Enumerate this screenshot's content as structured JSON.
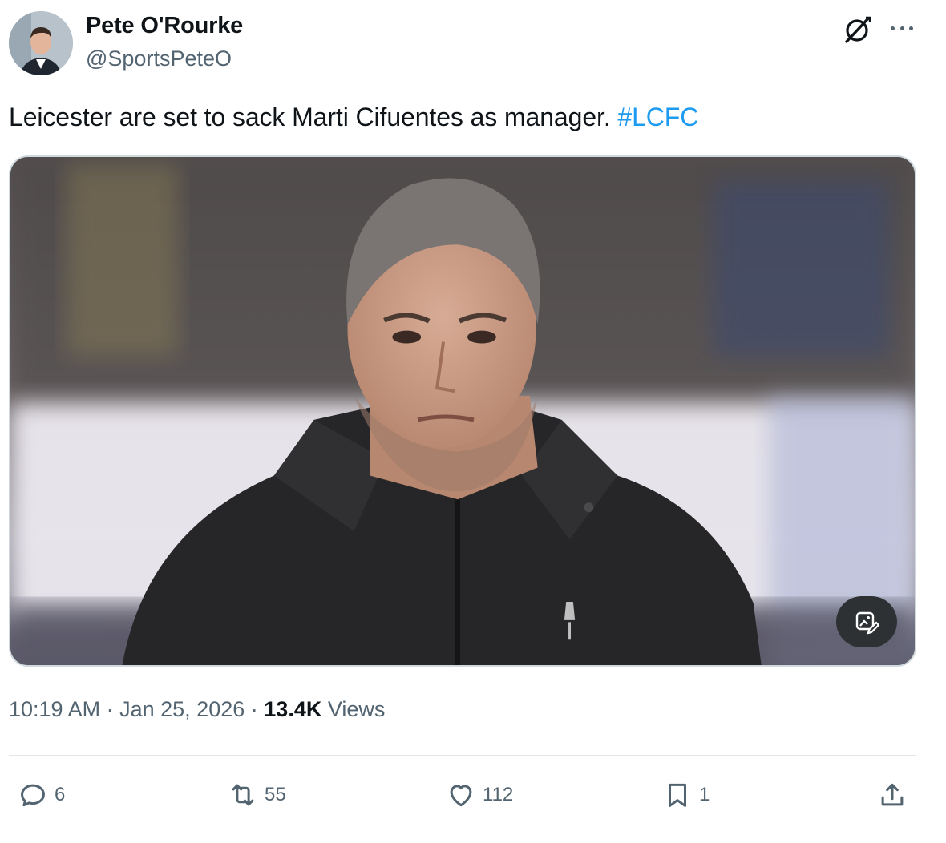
{
  "author": {
    "display_name": "Pete O'Rourke",
    "handle": "@SportsPeteO"
  },
  "tweet": {
    "text": "Leicester are set to sack Marti Cifuentes as manager.",
    "hashtag": "#LCFC"
  },
  "meta": {
    "time": "10:19 AM",
    "date": "Jan 25, 2026",
    "views_count": "13.4K",
    "views_label": "Views",
    "separator": "·"
  },
  "actions": {
    "replies": "6",
    "reposts": "55",
    "likes": "112",
    "bookmarks": "1"
  },
  "icons": {
    "grok": "grok-icon",
    "more": "more-dots-icon",
    "alt": "image-edit-icon",
    "reply": "reply-icon",
    "repost": "repost-icon",
    "like": "heart-icon",
    "bookmark": "bookmark-icon",
    "share": "share-icon"
  },
  "colors": {
    "accent": "#1d9bf0",
    "text": "#0f1419",
    "secondary": "#536471"
  }
}
